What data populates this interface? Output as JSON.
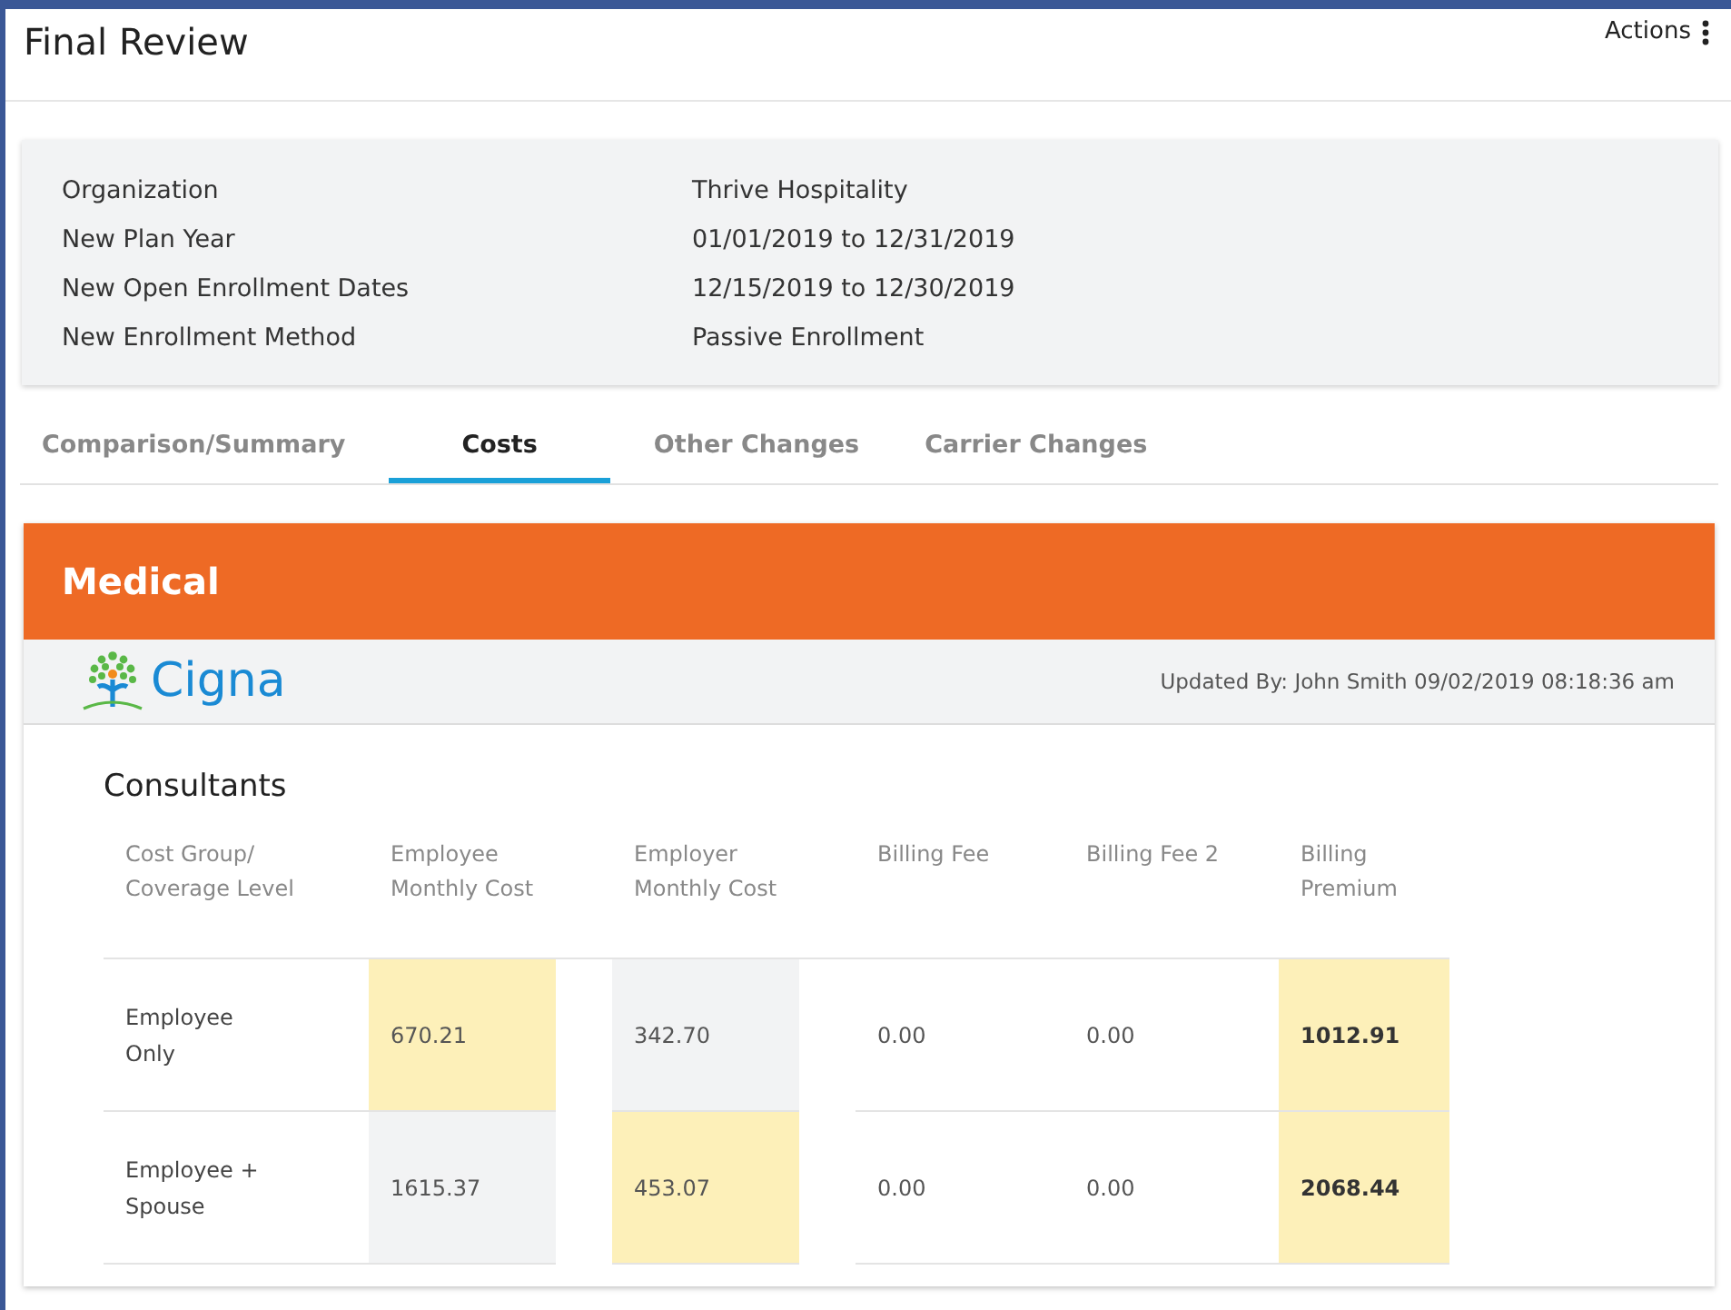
{
  "header": {
    "title": "Final Review",
    "actions": "Actions"
  },
  "summary": [
    {
      "label": "Organization",
      "value": "Thrive Hospitality"
    },
    {
      "label": "New Plan Year",
      "value": "01/01/2019 to 12/31/2019"
    },
    {
      "label": "New Open Enrollment Dates",
      "value": "12/15/2019 to 12/30/2019"
    },
    {
      "label": "New Enrollment Method",
      "value": "Passive Enrollment"
    }
  ],
  "tabs": [
    {
      "label": "Comparison/Summary",
      "selected": false
    },
    {
      "label": "Costs",
      "selected": true
    },
    {
      "label": "Other Changes",
      "selected": false
    },
    {
      "label": "Carrier Changes",
      "selected": false
    }
  ],
  "section": {
    "title": "Medical",
    "carrier": {
      "name": "Cigna",
      "updated": "Updated By: John Smith 09/02/2019 08:18:36 am"
    },
    "group": "Consultants",
    "table": {
      "columns": [
        "Cost Group/ Coverage Level",
        "Employee Monthly Cost",
        "Employer Monthly Cost",
        "Billing Fee",
        "Billing Fee 2",
        "Billing Premium"
      ],
      "rows": [
        [
          {
            "text": "Employee Only",
            "highlighted": false,
            "shaded": false,
            "bold": false
          },
          {
            "text": "670.21",
            "highlighted": true,
            "shaded": false,
            "bold": false
          },
          {
            "text": "342.70",
            "highlighted": false,
            "shaded": true,
            "bold": false
          },
          {
            "text": "0.00",
            "highlighted": false,
            "shaded": false,
            "bold": false
          },
          {
            "text": "0.00",
            "highlighted": false,
            "shaded": false,
            "bold": false
          },
          {
            "text": "1012.91",
            "highlighted": true,
            "shaded": false,
            "bold": true
          }
        ],
        [
          {
            "text": "Employee + Spouse",
            "highlighted": false,
            "shaded": false,
            "bold": false
          },
          {
            "text": "1615.37",
            "highlighted": false,
            "shaded": true,
            "bold": false
          },
          {
            "text": "453.07",
            "highlighted": true,
            "shaded": false,
            "bold": false
          },
          {
            "text": "0.00",
            "highlighted": false,
            "shaded": false,
            "bold": false
          },
          {
            "text": "0.00",
            "highlighted": false,
            "shaded": false,
            "bold": false
          },
          {
            "text": "2068.44",
            "highlighted": true,
            "shaded": false,
            "bold": true
          }
        ]
      ]
    }
  }
}
